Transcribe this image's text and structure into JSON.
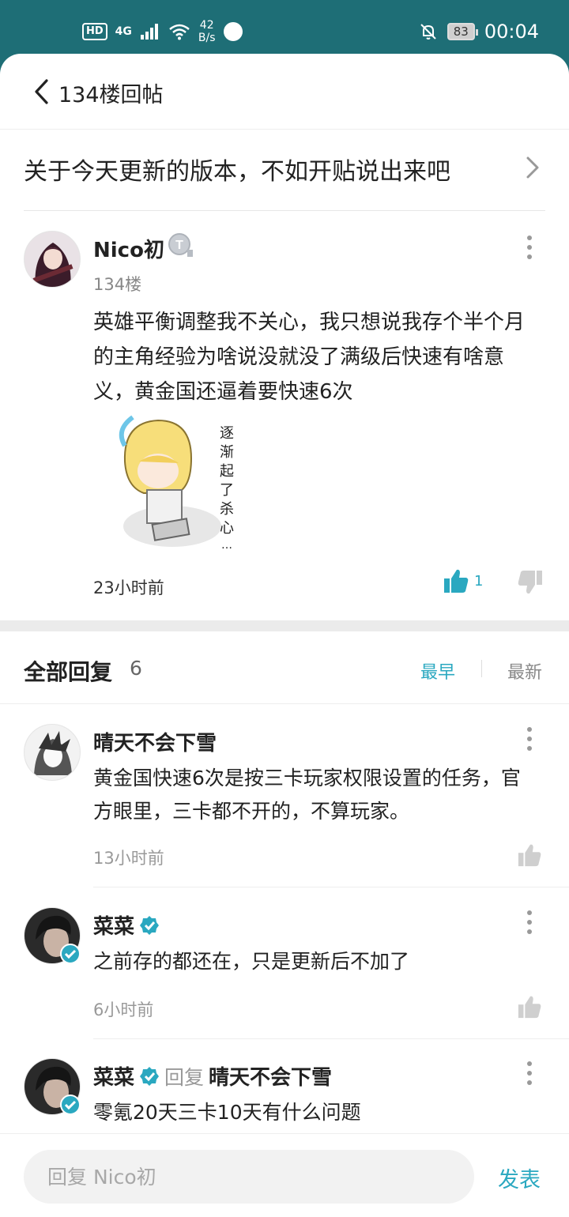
{
  "status_bar": {
    "hd": "HD",
    "network": "4G",
    "speed_value": "42",
    "speed_unit": "B/s",
    "battery": "83",
    "time": "00:04"
  },
  "header": {
    "title": "134楼回帖",
    "back_icon": "chevron-left-icon"
  },
  "thread": {
    "title": "关于今天更新的版本，不如开贴说出来吧"
  },
  "main_post": {
    "author": "Nico初",
    "level_badge": "T",
    "floor": "134楼",
    "content": "英雄平衡调整我不关心，我只想说我存个半个月的主角经验为啥说没就没了满级后快速有啥意义，黄金国还逼着要快速6次",
    "sticker_text": "逐渐起了杀心…",
    "time": "23小时前",
    "likes": "1"
  },
  "replies_header": {
    "title": "全部回复",
    "count": "6",
    "sort_earliest": "最早",
    "sort_newest": "最新"
  },
  "replies": [
    {
      "author": "晴天不会下雪",
      "verified": false,
      "text": "黄金国快速6次是按三卡玩家权限设置的任务，官方眼里，三卡都不开的，不算玩家。",
      "time": "13小时前"
    },
    {
      "author": "菜菜",
      "verified": true,
      "text": "之前存的都还在，只是更新后不加了",
      "time": "6小时前"
    },
    {
      "author": "菜菜",
      "verified": true,
      "reply_label": "回复",
      "reply_target": "晴天不会下雪",
      "text": "零氪20天三卡10天有什么问题"
    }
  ],
  "bottom_bar": {
    "input_placeholder": "回复 Nico初",
    "publish_label": "发表"
  },
  "colors": {
    "status_bar_bg": "#1e6e76",
    "accent": "#2aa8c0",
    "divider": "#ebebeb"
  }
}
